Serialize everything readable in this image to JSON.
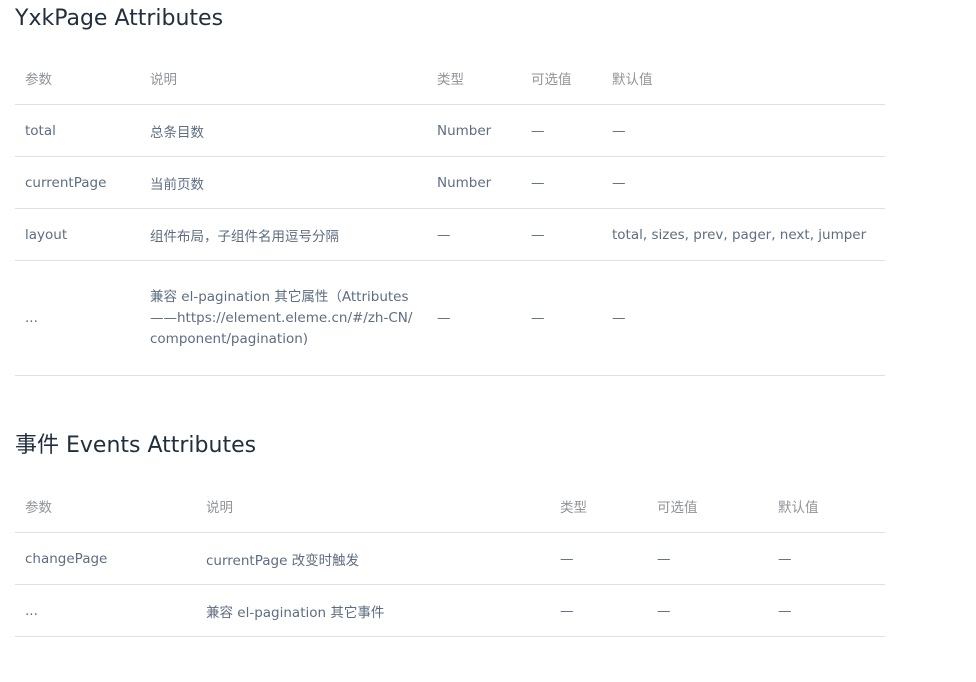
{
  "section1": {
    "title": "YxkPage Attributes",
    "headers": [
      "参数",
      "说明",
      "类型",
      "可选值",
      "默认值"
    ],
    "rows": [
      [
        "total",
        "总条目数",
        "Number",
        "—",
        "—"
      ],
      [
        "currentPage",
        "当前页数",
        "Number",
        "—",
        "—"
      ],
      [
        "layout",
        "组件布局，子组件名用逗号分隔",
        "—",
        "—",
        "total, sizes, prev, pager, next, jumper"
      ],
      [
        "...",
        "兼容 el-pagination 其它属性（Attributes——https://element.eleme.cn/#/zh-CN/component/pagination)",
        "—",
        "—",
        "—"
      ]
    ]
  },
  "section2": {
    "title": "事件 Events Attributes",
    "headers": [
      "参数",
      "说明",
      "类型",
      "可选值",
      "默认值"
    ],
    "rows": [
      [
        "changePage",
        "currentPage 改变时触发",
        "—",
        "—",
        "—"
      ],
      [
        "...",
        "兼容 el-pagination 其它事件",
        "—",
        "—",
        "—"
      ]
    ]
  }
}
